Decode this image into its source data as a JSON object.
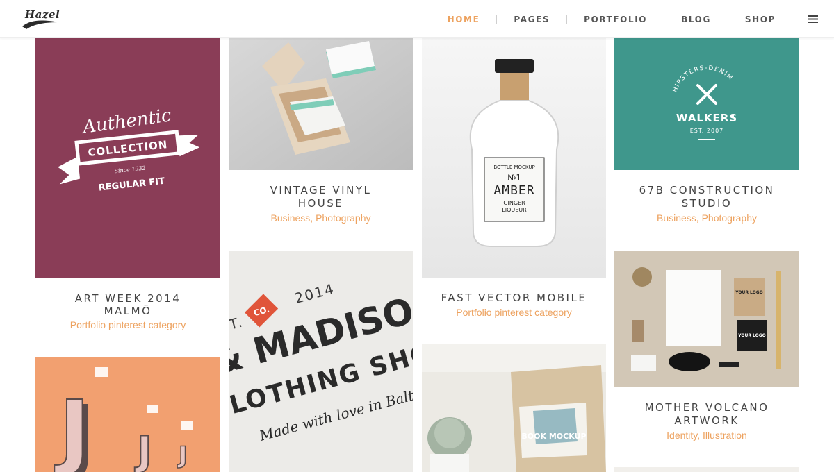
{
  "brand": {
    "logo_text": "Hazel"
  },
  "nav": {
    "items": [
      {
        "label": "HOME",
        "active": true
      },
      {
        "label": "PAGES",
        "active": false
      },
      {
        "label": "PORTFOLIO",
        "active": false
      },
      {
        "label": "BLOG",
        "active": false
      },
      {
        "label": "SHOP",
        "active": false
      }
    ],
    "menu_icon": "hamburger-icon"
  },
  "colors": {
    "accent": "#eda25f",
    "maroon": "#8a3d57",
    "teal": "#3f978c",
    "peach": "#f2a070"
  },
  "portfolio": [
    {
      "title_line1": "ART WEEK 2014",
      "title_line2": "MALMÖ",
      "category": "Portfolio pinterest category",
      "image": {
        "kind": "badge",
        "script": "Authentic",
        "banner": "COLLECTION",
        "since": "Since 1932",
        "bottom": "REGULAR FIT"
      }
    },
    {
      "title_line1": "VINTAGE VINYL",
      "title_line2": "HOUSE",
      "category": "Business, Photography",
      "image": {
        "kind": "business-card-box"
      }
    },
    {
      "title_line1": "FAST VECTOR MOBILE",
      "title_line2": "",
      "category": "Portfolio pinterest category",
      "image": {
        "kind": "bottle",
        "label_top": "BOTTLE MOCKUP",
        "label_num": "№1",
        "label_main": "AMBER",
        "label_sub1": "GINGER",
        "label_sub2": "LIQUEUR"
      }
    },
    {
      "title_line1": "67B CONSTRUCTION",
      "title_line2": "STUDIO",
      "category": "Business, Photography",
      "image": {
        "kind": "teal-logo",
        "arc": "HIPSTERS-DENIM",
        "main": "WALKERS",
        "est": "EST. 2007"
      }
    },
    {
      "title_line1": "",
      "title_line2": "",
      "category": "",
      "image": {
        "kind": "peach-letters",
        "letter": "J"
      }
    },
    {
      "title_line1": "",
      "title_line2": "",
      "category": "",
      "image": {
        "kind": "letterpress",
        "year": "2014",
        "tag": "CO.",
        "est": "EST.",
        "line1": "& MADISO",
        "line2": "LOTHING SHO",
        "line3": "Made with love in Baltimore"
      }
    },
    {
      "title_line1": "",
      "title_line2": "",
      "category": "",
      "image": {
        "kind": "book-mockup",
        "book_title": "BOOK MOCKUP"
      }
    },
    {
      "title_line1": "MOTHER VOLCANO",
      "title_line2": "ARTWORK",
      "category": "Identity, Illustration",
      "image": {
        "kind": "stationery",
        "logo": "YOUR LOGO"
      }
    }
  ]
}
